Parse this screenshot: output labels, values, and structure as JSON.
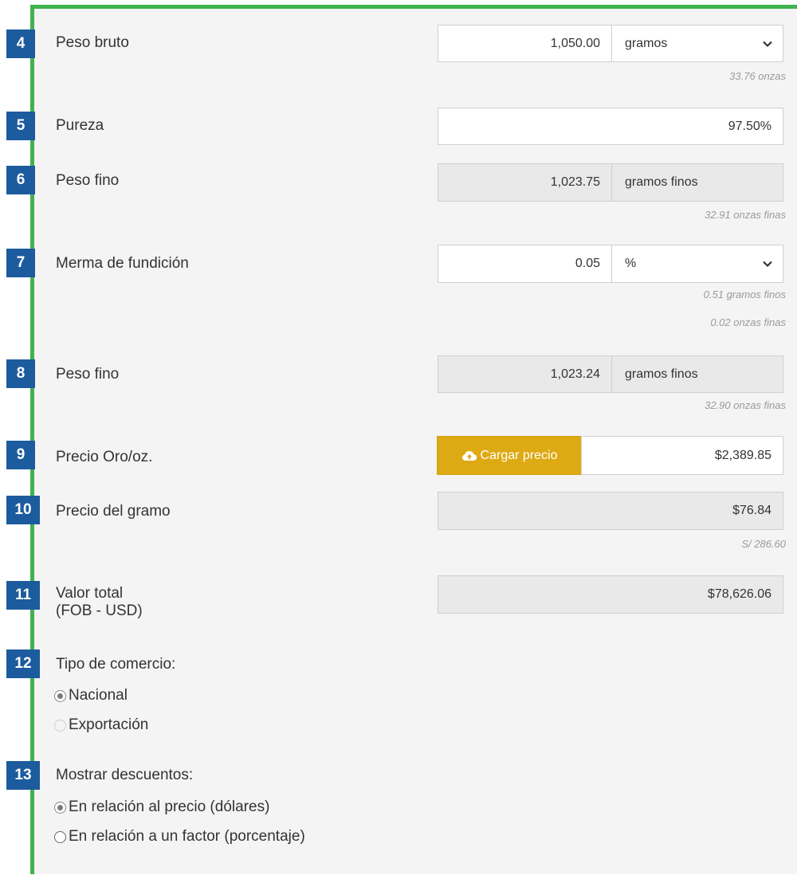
{
  "rows": [
    {
      "num": "4",
      "label": "Peso bruto",
      "value": "1,050.00",
      "unit": "gramos",
      "hint": "33.76 onzas"
    },
    {
      "num": "5",
      "label": "Pureza",
      "value": "97.50%"
    },
    {
      "num": "6",
      "label": "Peso fino",
      "value": "1,023.75",
      "unit": "gramos finos",
      "hint": "32.91 onzas finas"
    },
    {
      "num": "7",
      "label": "Merma de fundición",
      "value": "0.05",
      "unit": "%",
      "hint1": "0.51 gramos finos",
      "hint2": "0.02 onzas finas"
    },
    {
      "num": "8",
      "label": "Peso fino",
      "value": "1,023.24",
      "unit": "gramos finos",
      "hint": "32.90 onzas finas"
    },
    {
      "num": "9",
      "label": "Precio Oro/oz.",
      "button": "Cargar precio",
      "value": "$2,389.85"
    },
    {
      "num": "10",
      "label": "Precio del gramo",
      "value": "$76.84",
      "hint": "S/ 286.60"
    },
    {
      "num": "11",
      "label_line1": "Valor total",
      "label_line2": "(FOB - USD)",
      "value": "$78,626.06"
    },
    {
      "num": "12",
      "label": "Tipo de comercio:",
      "options": [
        "Nacional",
        "Exportación"
      ]
    },
    {
      "num": "13",
      "label": "Mostrar descuentos:",
      "options": [
        "En relación al precio (dólares)",
        "En relación a un factor (porcentaje)"
      ]
    }
  ],
  "icons": {
    "chevron": "chevron-down-icon",
    "cloud": "cloud-upload-icon"
  },
  "colors": {
    "border_green": "#3fb34f",
    "badge_blue": "#1c5b9e",
    "button_gold": "#ddaa13"
  }
}
